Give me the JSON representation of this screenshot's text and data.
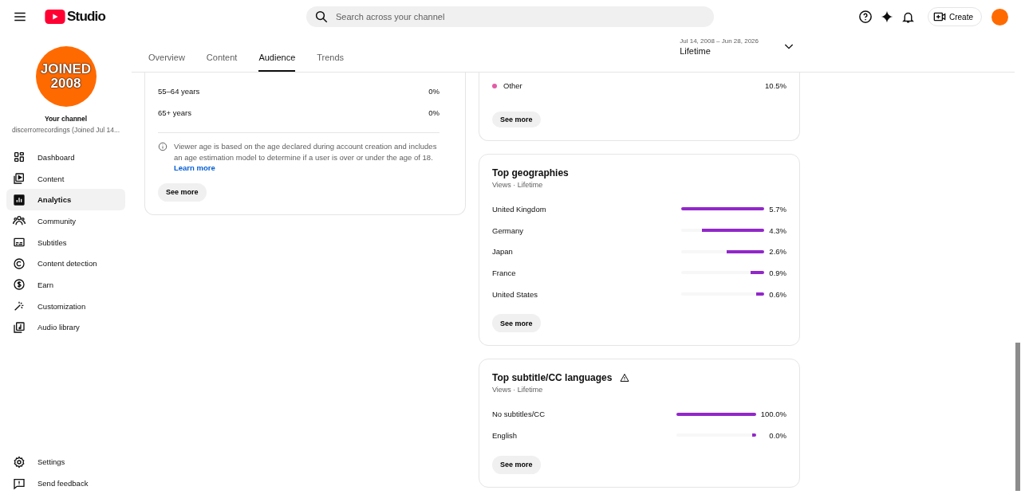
{
  "header": {
    "logo_text": "Studio",
    "search": {
      "placeholder": "Search across your channel"
    },
    "create_label": "Create"
  },
  "sidebar": {
    "avatar": {
      "line_1": "JOINED",
      "line_2": "2008"
    },
    "channel_label": "Your channel",
    "channel_name": "discerrorrecordings (Joined Jul 14...",
    "items": [
      {
        "label": "Dashboard",
        "selected": false
      },
      {
        "label": "Content",
        "selected": false
      },
      {
        "label": "Analytics",
        "selected": true
      },
      {
        "label": "Community",
        "selected": false
      },
      {
        "label": "Subtitles",
        "selected": false
      },
      {
        "label": "Content detection",
        "selected": false
      },
      {
        "label": "Earn",
        "selected": false
      },
      {
        "label": "Customization",
        "selected": false
      },
      {
        "label": "Audio library",
        "selected": false
      }
    ],
    "footer_items": [
      {
        "label": "Settings"
      },
      {
        "label": "Send feedback"
      }
    ]
  },
  "tabs": [
    {
      "label": "Overview",
      "selected": false
    },
    {
      "label": "Content",
      "selected": false
    },
    {
      "label": "Audience",
      "selected": true
    },
    {
      "label": "Trends",
      "selected": false
    }
  ],
  "date_range": {
    "range": "Jul 14, 2008 – Jun 28, 2026",
    "label": "Lifetime"
  },
  "age_card": {
    "rows": [
      {
        "label": "55–64 years",
        "value": "0%"
      },
      {
        "label": "65+ years",
        "value": "0%"
      }
    ],
    "note": "Viewer age is based on the age declared during account creation and includes an age estimation model to determine if a user is over or under the age of 18.",
    "link": "Learn more",
    "button": "See more"
  },
  "device_card": {
    "rows": [
      {
        "label": "Other",
        "value": "10.5%",
        "color": "#e25ca6"
      }
    ],
    "button": "See more"
  },
  "geo_card": {
    "title": "Top geographies",
    "subtitle": "Views · Lifetime",
    "rows": [
      {
        "label": "United Kingdom",
        "level": 1.0,
        "value": "5.7%"
      },
      {
        "label": "Germany",
        "level": 0.75,
        "value": "4.3%"
      },
      {
        "label": "Japan",
        "level": 0.45,
        "value": "2.6%"
      },
      {
        "label": "France",
        "level": 0.16,
        "value": "0.9%"
      },
      {
        "label": "United States",
        "level": 0.1,
        "value": "0.6%"
      }
    ],
    "button": "See more"
  },
  "subtitle_card": {
    "title": "Top subtitle/CC languages",
    "subtitle": "Views · Lifetime",
    "rows": [
      {
        "label": "No subtitles/CC",
        "level": 1.0,
        "value": "100.0%"
      },
      {
        "label": "English",
        "level": 0.05,
        "value": "0.0%"
      }
    ],
    "button": "See more"
  }
}
